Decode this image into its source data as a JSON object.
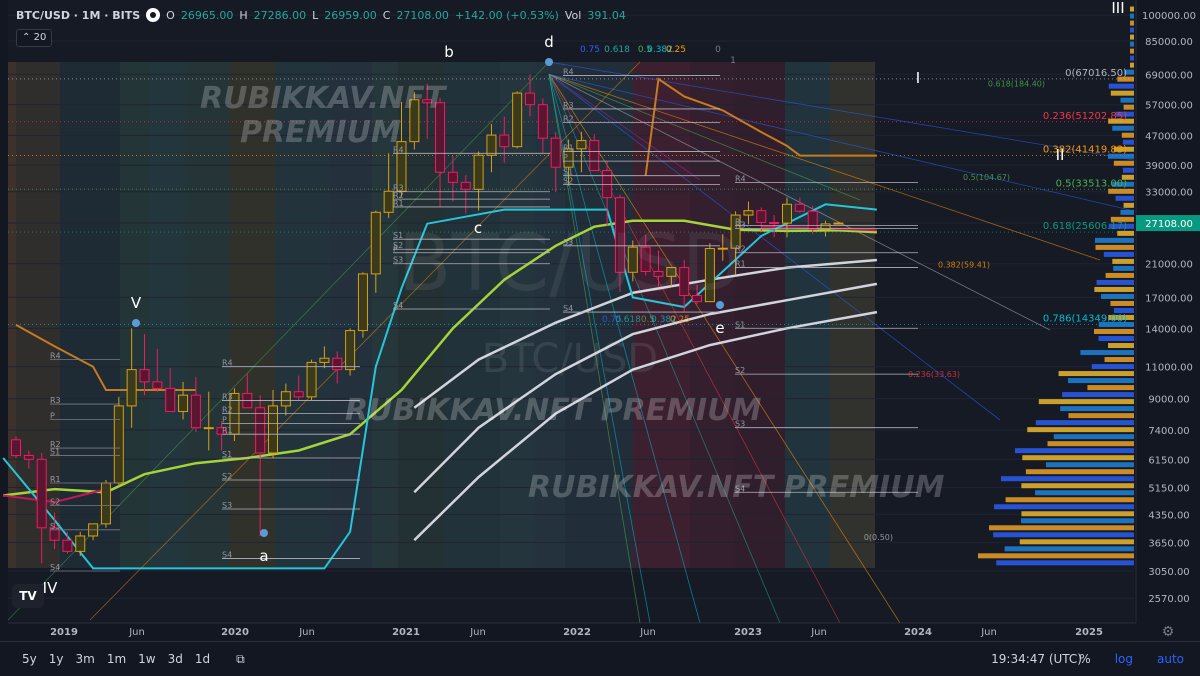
{
  "legend": {
    "symbol": "BTC/USD · 1M · BITS",
    "o_label": "O",
    "o_value": "26965.00",
    "h_label": "H",
    "h_value": "27286.00",
    "l_label": "L",
    "l_value": "26959.00",
    "c_label": "C",
    "c_value": "27108.00",
    "change": "+142.00 (+0.53%)",
    "vol_label": "Vol",
    "vol_value": "391.04"
  },
  "indicator_badge": "20",
  "watermarks": {
    "big": "BTC/USD",
    "small": "BTC/USD",
    "premium1": "RUBIKKAV.NFT",
    "premium2": "PREMIUM",
    "premium3": "RUBIKKAV.NFT PREMIUM",
    "premium4": "RUBIKKAV.NFT PREMIUM"
  },
  "chart_data": {
    "type": "candlestick",
    "title": "BTC/USD · 1M · BITS",
    "y_scale": "log",
    "ylim": [
      2200,
      110000
    ],
    "x_ticks": [
      "2019",
      "Jun",
      "2020",
      "Jun",
      "2021",
      "Jun",
      "2022",
      "Jun",
      "2023",
      "Jun",
      "2024",
      "Jun",
      "2025"
    ],
    "y_ticks": [
      "100000.00",
      "85000.00",
      "69000.00",
      "57000.00",
      "47000.00",
      "39000.00",
      "33000.00",
      "27108.00",
      "21000.00",
      "17000.00",
      "14000.00",
      "11000.00",
      "9000.00",
      "7400.00",
      "6150.00",
      "5150.00",
      "4350.00",
      "3650.00",
      "3050.00",
      "2570.00"
    ],
    "y_tick_values": [
      100000,
      85000,
      69000,
      57000,
      47000,
      39000,
      33000,
      27108,
      21000,
      17000,
      14000,
      11000,
      9000,
      7400,
      6150,
      5150,
      4350,
      3650,
      3050,
      2570
    ],
    "last_price": "27108.00",
    "candles": [
      {
        "o": 6950,
        "h": 7100,
        "l": 6200,
        "c": 6300
      },
      {
        "o": 6300,
        "h": 6500,
        "l": 5800,
        "c": 6150
      },
      {
        "o": 6150,
        "h": 6400,
        "l": 3200,
        "c": 4000
      },
      {
        "o": 4000,
        "h": 4400,
        "l": 3500,
        "c": 3700
      },
      {
        "o": 3700,
        "h": 3900,
        "l": 3400,
        "c": 3450
      },
      {
        "o": 3450,
        "h": 3900,
        "l": 3350,
        "c": 3800
      },
      {
        "o": 3800,
        "h": 4100,
        "l": 3700,
        "c": 4100
      },
      {
        "o": 4100,
        "h": 5400,
        "l": 4000,
        "c": 5300
      },
      {
        "o": 5300,
        "h": 9100,
        "l": 5200,
        "c": 8600
      },
      {
        "o": 8600,
        "h": 14000,
        "l": 7500,
        "c": 10800
      },
      {
        "o": 10800,
        "h": 13500,
        "l": 9200,
        "c": 10000
      },
      {
        "o": 10000,
        "h": 12300,
        "l": 9400,
        "c": 9600
      },
      {
        "o": 9600,
        "h": 10900,
        "l": 9200,
        "c": 8300
      },
      {
        "o": 8300,
        "h": 10000,
        "l": 7900,
        "c": 9200
      },
      {
        "o": 9200,
        "h": 10300,
        "l": 7300,
        "c": 7500
      },
      {
        "o": 7500,
        "h": 9400,
        "l": 6500,
        "c": 7500
      },
      {
        "o": 7500,
        "h": 7800,
        "l": 6500,
        "c": 7200
      },
      {
        "o": 7200,
        "h": 9600,
        "l": 6900,
        "c": 9300
      },
      {
        "o": 9300,
        "h": 10500,
        "l": 8500,
        "c": 8500
      },
      {
        "o": 8500,
        "h": 9200,
        "l": 3800,
        "c": 6400
      },
      {
        "o": 6400,
        "h": 9500,
        "l": 6200,
        "c": 8600
      },
      {
        "o": 8600,
        "h": 9900,
        "l": 8100,
        "c": 9400
      },
      {
        "o": 9400,
        "h": 10400,
        "l": 8900,
        "c": 9100
      },
      {
        "o": 9100,
        "h": 11500,
        "l": 8900,
        "c": 11300
      },
      {
        "o": 11300,
        "h": 12500,
        "l": 10900,
        "c": 11600
      },
      {
        "o": 11600,
        "h": 12100,
        "l": 9900,
        "c": 10800
      },
      {
        "o": 10800,
        "h": 14000,
        "l": 10400,
        "c": 13800
      },
      {
        "o": 13800,
        "h": 19900,
        "l": 13200,
        "c": 19700
      },
      {
        "o": 19700,
        "h": 29300,
        "l": 17500,
        "c": 29000
      },
      {
        "o": 29000,
        "h": 42000,
        "l": 28000,
        "c": 33100
      },
      {
        "o": 33100,
        "h": 58000,
        "l": 32000,
        "c": 45200
      },
      {
        "o": 45200,
        "h": 61700,
        "l": 43000,
        "c": 58800
      },
      {
        "o": 58800,
        "h": 65000,
        "l": 46000,
        "c": 57700
      },
      {
        "o": 57700,
        "h": 59500,
        "l": 30000,
        "c": 37300
      },
      {
        "o": 37300,
        "h": 41300,
        "l": 31000,
        "c": 35000
      },
      {
        "o": 35000,
        "h": 36600,
        "l": 28800,
        "c": 33500
      },
      {
        "o": 33500,
        "h": 42500,
        "l": 29300,
        "c": 41500
      },
      {
        "o": 41500,
        "h": 50500,
        "l": 37300,
        "c": 47100
      },
      {
        "o": 47100,
        "h": 52900,
        "l": 39600,
        "c": 43800
      },
      {
        "o": 43800,
        "h": 62000,
        "l": 43300,
        "c": 61300
      },
      {
        "o": 61300,
        "h": 69000,
        "l": 53000,
        "c": 57000
      },
      {
        "o": 57000,
        "h": 59300,
        "l": 42000,
        "c": 46200
      },
      {
        "o": 46200,
        "h": 48000,
        "l": 32900,
        "c": 38500
      },
      {
        "o": 38500,
        "h": 45800,
        "l": 34300,
        "c": 43200
      },
      {
        "o": 43200,
        "h": 48100,
        "l": 37300,
        "c": 45500
      },
      {
        "o": 45500,
        "h": 47400,
        "l": 37600,
        "c": 37700
      },
      {
        "o": 37700,
        "h": 40000,
        "l": 26700,
        "c": 31800
      },
      {
        "o": 31800,
        "h": 32400,
        "l": 17600,
        "c": 19900
      },
      {
        "o": 19900,
        "h": 24300,
        "l": 18800,
        "c": 23300
      },
      {
        "o": 23300,
        "h": 25200,
        "l": 19500,
        "c": 20000
      },
      {
        "o": 20000,
        "h": 22800,
        "l": 18200,
        "c": 19400
      },
      {
        "o": 19400,
        "h": 20500,
        "l": 18200,
        "c": 20500
      },
      {
        "o": 20500,
        "h": 21500,
        "l": 15500,
        "c": 17200
      },
      {
        "o": 17200,
        "h": 18400,
        "l": 16300,
        "c": 16550
      },
      {
        "o": 16550,
        "h": 23900,
        "l": 16500,
        "c": 23100
      },
      {
        "o": 23100,
        "h": 25300,
        "l": 21400,
        "c": 23150
      },
      {
        "o": 23150,
        "h": 29200,
        "l": 19600,
        "c": 28500
      },
      {
        "o": 28500,
        "h": 31000,
        "l": 26900,
        "c": 29300
      },
      {
        "o": 29300,
        "h": 29900,
        "l": 25800,
        "c": 27200
      },
      {
        "o": 27200,
        "h": 28500,
        "l": 24800,
        "c": 27100
      },
      {
        "o": 27100,
        "h": 31800,
        "l": 24800,
        "c": 30500
      },
      {
        "o": 30500,
        "h": 31800,
        "l": 28900,
        "c": 29200
      },
      {
        "o": 29200,
        "h": 30200,
        "l": 25300,
        "c": 26050
      },
      {
        "o": 26050,
        "h": 27500,
        "l": 24900,
        "c": 26970
      },
      {
        "o": 26965,
        "h": 27286,
        "l": 26959,
        "c": 27108
      }
    ],
    "wave_labels": [
      "V",
      "a",
      "b",
      "c",
      "d",
      "e",
      "IV",
      "I",
      "II",
      "III"
    ],
    "pivot_labels": [
      "R4",
      "R3",
      "R2",
      "R1",
      "P",
      "S1",
      "S2",
      "S3",
      "S4"
    ],
    "fib_labels": [
      {
        "text": "0(67016.50)",
        "price": 67016.5,
        "color": "#b2b5be"
      },
      {
        "text": "0.236(51202.85)",
        "price": 51202.85,
        "color": "#f23645"
      },
      {
        "text": "0.382(41419.83)",
        "price": 41419.83,
        "color": "#ff9800"
      },
      {
        "text": "0.5(33513.00)",
        "price": 33513,
        "color": "#4caf50"
      },
      {
        "text": "0.618(25606.17)",
        "price": 25606.17,
        "color": "#089981"
      },
      {
        "text": "0.786(14349.00)",
        "price": 14349,
        "color": "#00bcd4"
      },
      {
        "text": "0.618(184.40)",
        "price": 64000,
        "color": "#4caf50"
      },
      {
        "text": "0.5(104.67)",
        "price": 35500,
        "color": "#4caf50"
      },
      {
        "text": "0.382(59.41)",
        "price": 20500,
        "color": "#ff9800"
      },
      {
        "text": "0.236(33.63)",
        "price": 10300,
        "color": "#f23645"
      },
      {
        "text": "0(0.50)",
        "price": 3700,
        "color": "#b2b5be"
      }
    ],
    "fan_labels": [
      "0.75",
      "0.618",
      "0.5",
      "0.382",
      "0.25",
      "0",
      "1"
    ],
    "fan_labels_low": [
      "0.75",
      "0.618",
      "0.5",
      "0.382",
      "0.25"
    ]
  },
  "toolbar": {
    "ranges": [
      "5y",
      "1y",
      "3m",
      "1m",
      "1w",
      "3d",
      "1d"
    ],
    "clock": "19:34:47 (UTC)",
    "percent": "%",
    "log": "log",
    "auto": "auto"
  },
  "logo_text": "TV"
}
